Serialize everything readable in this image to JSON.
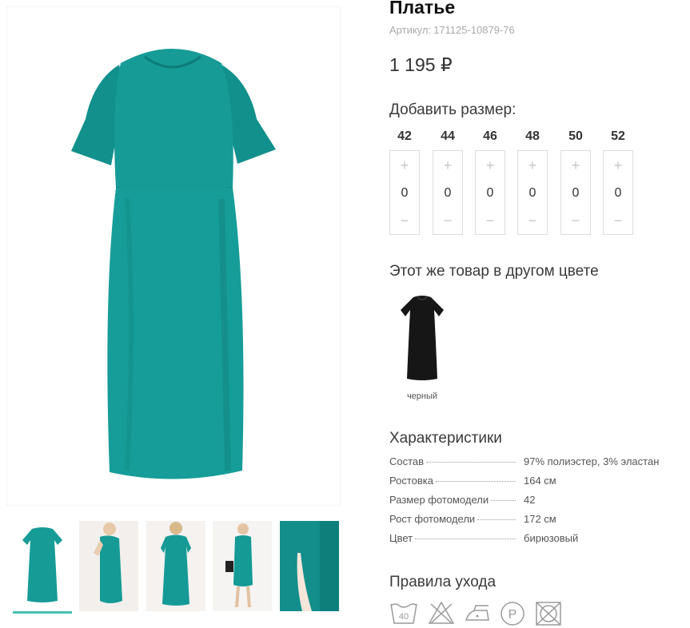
{
  "product": {
    "title": "Платье",
    "sku_label": "Артикул:",
    "sku_value": "171125-10879-76",
    "price": "1 195 ₽"
  },
  "sizes": {
    "heading": "Добавить размер:",
    "items": [
      {
        "size": "42",
        "qty": "0",
        "plus": "+",
        "minus": "−"
      },
      {
        "size": "44",
        "qty": "0",
        "plus": "+",
        "minus": "−"
      },
      {
        "size": "46",
        "qty": "0",
        "plus": "+",
        "minus": "−"
      },
      {
        "size": "48",
        "qty": "0",
        "plus": "+",
        "minus": "−"
      },
      {
        "size": "50",
        "qty": "0",
        "plus": "+",
        "minus": "−"
      },
      {
        "size": "52",
        "qty": "0",
        "plus": "+",
        "minus": "−"
      }
    ]
  },
  "other_color": {
    "heading": "Этот же товар в другом цвете",
    "option_label": "черный"
  },
  "specs": {
    "heading": "Характеристики",
    "rows": [
      {
        "key": "Состав",
        "value": "97% полиэстер, 3% эластан"
      },
      {
        "key": "Ростовка",
        "value": "164 см"
      },
      {
        "key": "Размер фотомодели",
        "value": "42"
      },
      {
        "key": "Рост фотомодели",
        "value": "172 см"
      },
      {
        "key": "Цвет",
        "value": "бирюзовый"
      }
    ]
  },
  "care": {
    "heading": "Правила ухода",
    "wash_temp": "40",
    "icons": [
      "wash-40-icon",
      "no-bleach-icon",
      "iron-low-icon",
      "dry-clean-p-icon",
      "no-tumble-dry-icon"
    ]
  },
  "gallery": {
    "thumbnails": [
      "thumb-front",
      "thumb-side",
      "thumb-back",
      "thumb-model",
      "thumb-detail"
    ],
    "active_index": 0
  },
  "colors": {
    "teal": "#159a96",
    "teal_dark": "#0e7f7c",
    "accent": "#46c0b3",
    "black_dress": "#161616"
  }
}
